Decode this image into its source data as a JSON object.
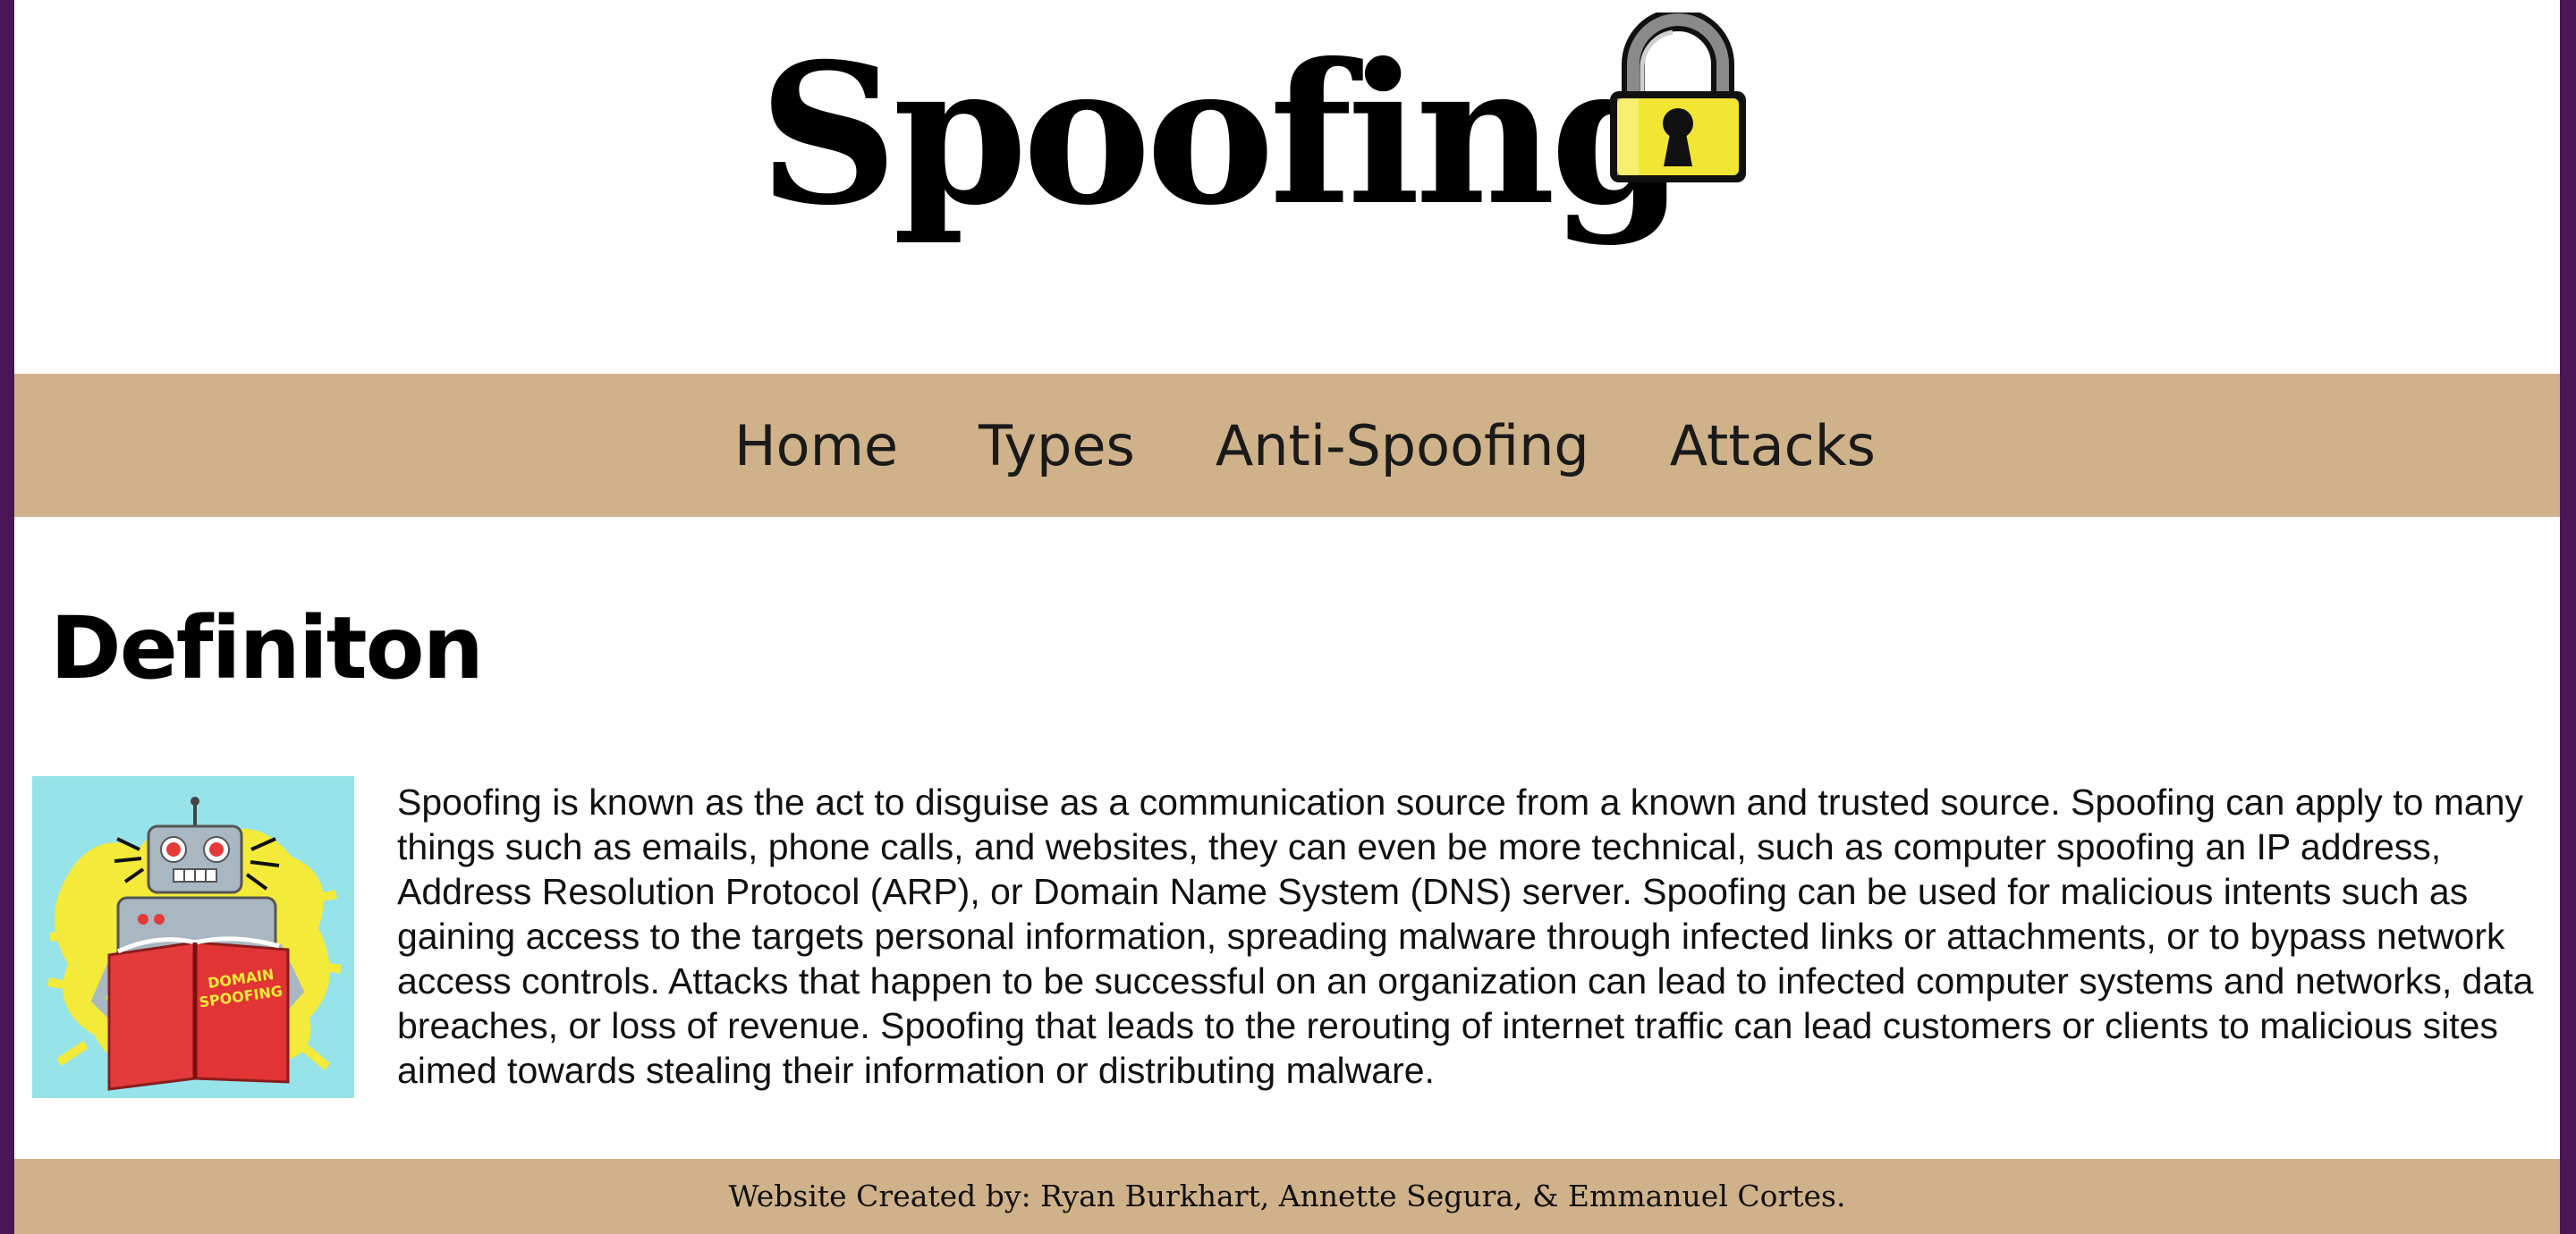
{
  "header": {
    "title": "Spoofing",
    "logo_icon": "padlock-icon"
  },
  "nav": {
    "items": [
      {
        "label": "Home"
      },
      {
        "label": "Types"
      },
      {
        "label": "Anti-Spoofing"
      },
      {
        "label": "Attacks"
      }
    ]
  },
  "main": {
    "heading": "Definiton",
    "image": {
      "icon": "robot-reading-domain-spoofing-book-illustration",
      "book_text": "DOMAIN SPOOFING"
    },
    "paragraph": "Spoofing is known as the act to disguise as a communication source from a known and trusted source. Spoofing can apply to many things such as emails, phone calls, and websites, they can even be more technical, such as computer spoofing an IP address, Address Resolution Protocol (ARP), or Domain Name System (DNS) server. Spoofing can be used for malicious intents such as gaining access to the targets personal information, spreading malware through infected links or attachments, or to bypass network access controls. Attacks that happen to be successful on an organization can lead to infected computer systems and networks, data breaches, or loss of revenue. Spoofing that leads to the rerouting of internet traffic can lead customers or clients to malicious sites aimed towards stealing their information or distributing malware."
  },
  "footer": {
    "text": "Website Created by: Ryan Burkhart, Annette Segura, & Emmanuel Cortes."
  },
  "colors": {
    "nav_background": "#d0b28a",
    "side_border": "#4a1655",
    "lock_body": "#f2e635",
    "image_background": "#96e4ea",
    "book_red": "#e53a3a"
  }
}
